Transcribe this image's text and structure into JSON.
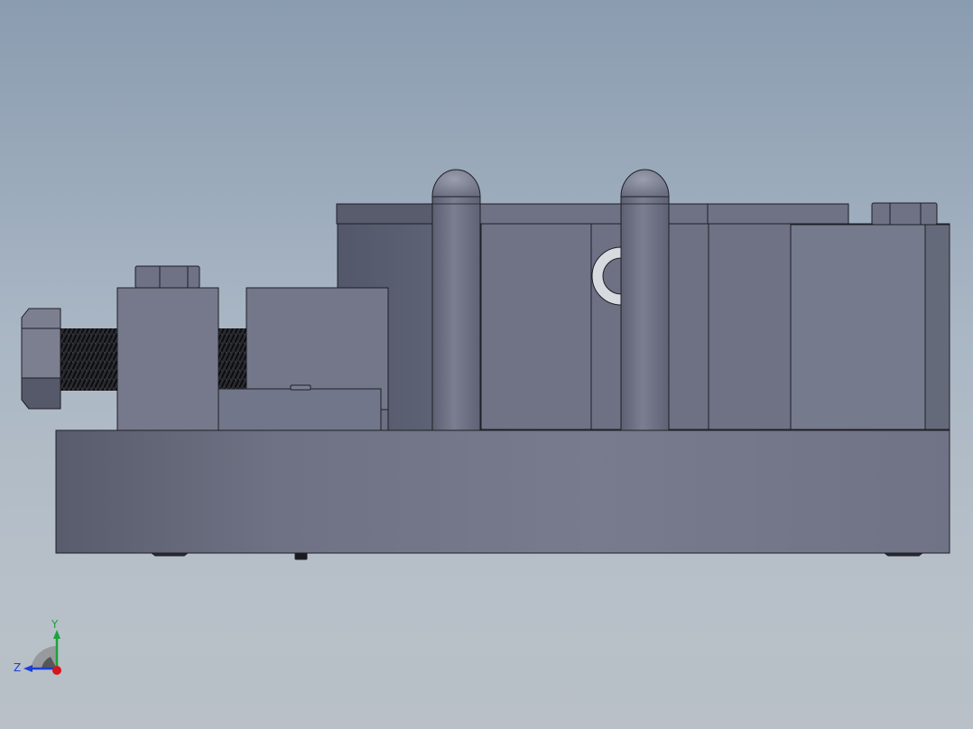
{
  "viewport": {
    "background_top": "#8a9cb0",
    "background_bottom": "#b9c0c7"
  },
  "model": {
    "part_color": "#737789",
    "edge_color": "#1e1f26",
    "shadow_color": "#4f5262"
  },
  "triad": {
    "labels": {
      "y": "Y",
      "z": "Z"
    },
    "colors": {
      "x": "#d4171c",
      "y": "#1aa33a",
      "z": "#1a3fd8"
    }
  }
}
